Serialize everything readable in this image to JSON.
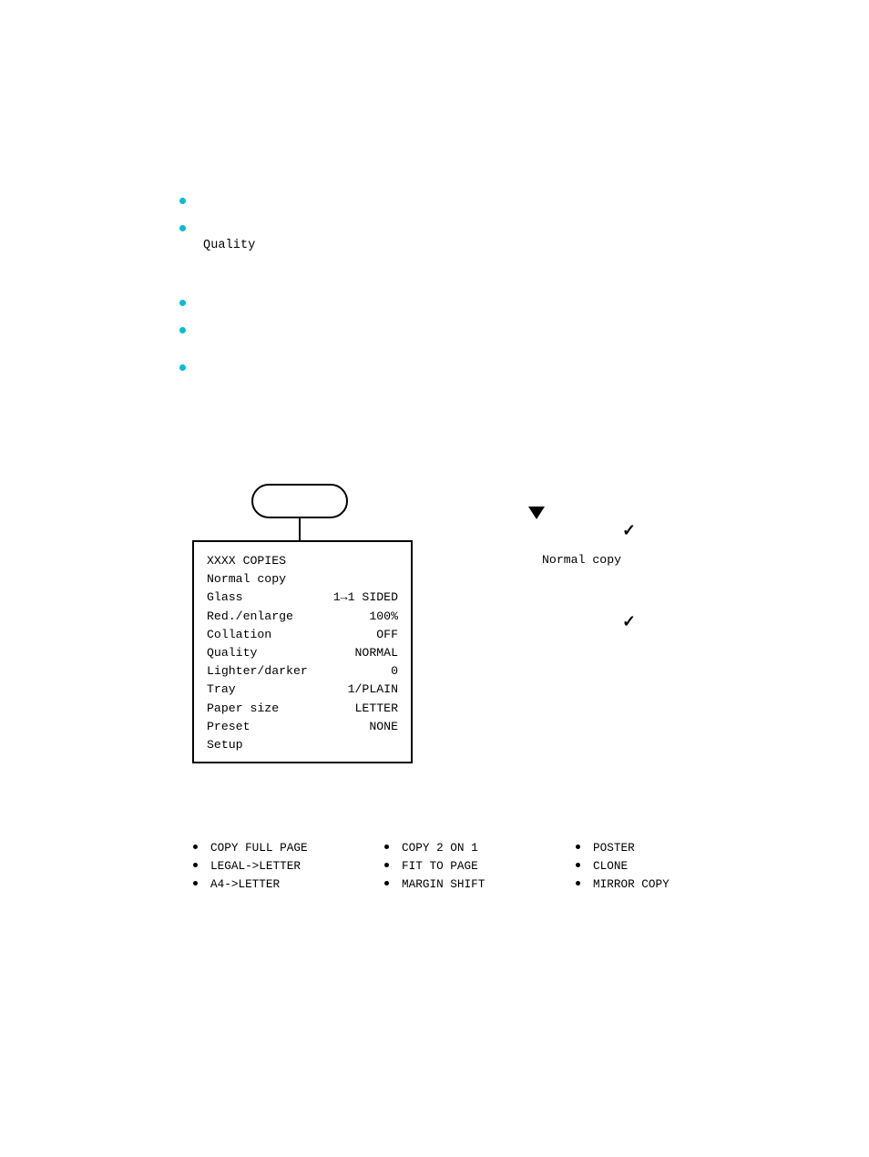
{
  "notes": {
    "b1": "",
    "b2": "",
    "quality_label": "Quality",
    "b3": "",
    "b4": "",
    "b5": ""
  },
  "right": {
    "normal_copy": "Normal copy"
  },
  "lcd": {
    "title": "XXXX COPIES",
    "mode": "Normal copy",
    "rows": [
      {
        "l": "Glass",
        "r": "1→1 SIDED"
      },
      {
        "l": "Red./enlarge",
        "r": "100%"
      },
      {
        "l": "Collation",
        "r": "OFF"
      },
      {
        "l": "Quality",
        "r": "NORMAL"
      },
      {
        "l": "Lighter/darker",
        "r": "0"
      },
      {
        "l": "Tray",
        "r": "1/PLAIN"
      },
      {
        "l": "Paper size",
        "r": "LETTER"
      },
      {
        "l": "Preset",
        "r": "NONE"
      },
      {
        "l": "Setup",
        "r": ""
      }
    ]
  },
  "bottom": {
    "col1": [
      "COPY FULL PAGE",
      "LEGAL->LETTER",
      "A4->LETTER"
    ],
    "col2": [
      "COPY 2 ON 1",
      "FIT TO PAGE",
      "MARGIN SHIFT"
    ],
    "col3": [
      "POSTER",
      "CLONE",
      "MIRROR COPY"
    ]
  }
}
